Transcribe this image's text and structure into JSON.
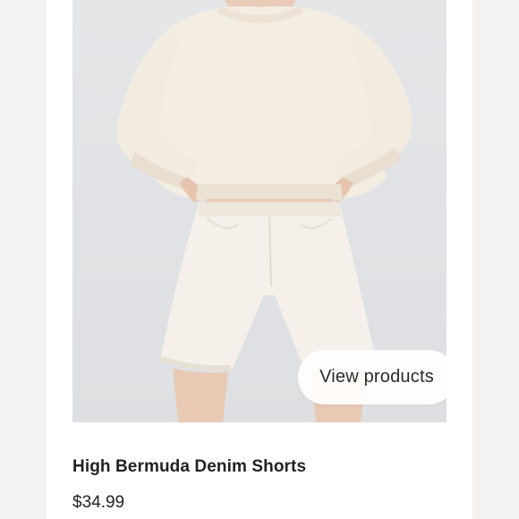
{
  "product": {
    "image_alt": "Model wearing cream knit sweater and white bermuda denim shorts",
    "cta_label": "View products",
    "name": "High Bermuda Denim Shorts",
    "price": "$34.99"
  },
  "colors": {
    "background": "#f3f2f1",
    "card": "#ffffff",
    "text": "#222222"
  }
}
